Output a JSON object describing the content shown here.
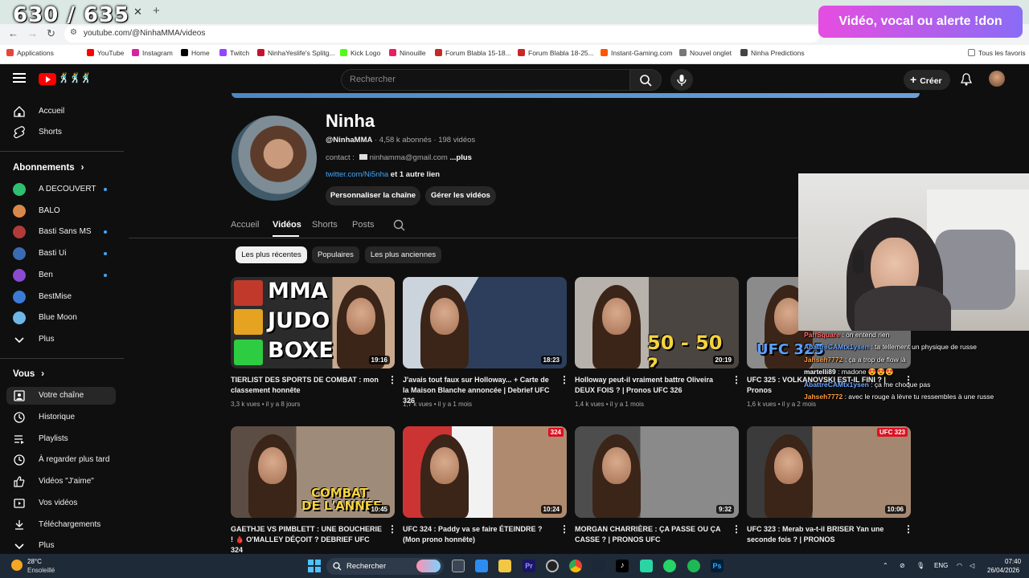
{
  "overlay": {
    "counter": "630 / 635",
    "donation_banner": "Vidéo, vocal ou alerte !don"
  },
  "browser": {
    "url": "youtube.com/@NinhaMMA/videos",
    "bookmarks": [
      {
        "label": "Applications",
        "color": "#e8453c"
      },
      {
        "label": "YouTube",
        "color": "#ff0000"
      },
      {
        "label": "Instagram",
        "color": "#d6249f"
      },
      {
        "label": "Home",
        "color": "#000000"
      },
      {
        "label": "Twitch",
        "color": "#9146ff"
      },
      {
        "label": "NinhaYeslife's Splitg...",
        "color": "#c8102e"
      },
      {
        "label": "Kick Logo",
        "color": "#53fc18"
      },
      {
        "label": "Ninouille",
        "color": "#e91e63"
      },
      {
        "label": "Forum Blabla 15-18...",
        "color": "#c62828"
      },
      {
        "label": "Forum Blabla 18-25...",
        "color": "#c62828"
      },
      {
        "label": "Instant-Gaming.com",
        "color": "#ff5400"
      },
      {
        "label": "Nouvel onglet",
        "color": "#777777"
      },
      {
        "label": "Ninha Predictions",
        "color": "#444444"
      }
    ],
    "all_bookmarks": "Tous les favoris"
  },
  "header": {
    "search_placeholder": "Rechercher",
    "create_label": "Créer"
  },
  "sidebar": {
    "main": [
      {
        "label": "Accueil",
        "icon": "home-icon"
      },
      {
        "label": "Shorts",
        "icon": "shorts-icon"
      }
    ],
    "subscriptions_title": "Abonnements",
    "subscriptions": [
      {
        "label": "A DECOUVERT",
        "color": "#2fbf71",
        "dot": true
      },
      {
        "label": "BALO",
        "color": "#d9884a",
        "dot": false
      },
      {
        "label": "Basti Sans MS",
        "color": "#b23a3a",
        "dot": true
      },
      {
        "label": "Basti Ui",
        "color": "#3a6ab2",
        "dot": true
      },
      {
        "label": "Ben",
        "color": "#8a4bd0",
        "dot": true
      },
      {
        "label": "BestMise",
        "color": "#3b7bd6",
        "dot": false
      },
      {
        "label": "Blue Moon",
        "color": "#6fb6e8",
        "dot": false
      }
    ],
    "subscriptions_more": "Plus",
    "you_title": "Vous",
    "you_items": [
      {
        "label": "Votre chaîne",
        "icon": "channel-icon",
        "active": true
      },
      {
        "label": "Historique",
        "icon": "history-icon",
        "active": false
      },
      {
        "label": "Playlists",
        "icon": "playlists-icon",
        "active": false
      },
      {
        "label": "À regarder plus tard",
        "icon": "watch-later-icon",
        "active": false
      },
      {
        "label": "Vidéos \"J'aime\"",
        "icon": "like-icon",
        "active": false
      },
      {
        "label": "Vos vidéos",
        "icon": "your-videos-icon",
        "active": false
      },
      {
        "label": "Téléchargements",
        "icon": "download-icon",
        "active": false
      }
    ],
    "you_more": "Plus"
  },
  "channel": {
    "name": "Ninha",
    "handle": "@NinhaMMA",
    "stats": " · 4,58 k abonnés · 198 vidéos",
    "contact_label": "contact : ",
    "contact_email": "ninhamma@gmail.com",
    "contact_more": "...plus",
    "link": "twitter.com/Ni5nha",
    "link_more": " et 1 autre lien",
    "customize_button": "Personnaliser la chaîne",
    "manage_button": "Gérer les vidéos",
    "tabs": [
      "Accueil",
      "Vidéos",
      "Shorts",
      "Posts"
    ],
    "active_tab": "Vidéos",
    "filters": [
      "Les plus récentes",
      "Populaires",
      "Les plus anciennes"
    ],
    "active_filter": "Les plus récentes"
  },
  "videos": [
    {
      "title": "TIERLIST DES SPORTS DE COMBAT : mon classement honnête",
      "views": "3,3 k vues",
      "age": "il y a 8 jours",
      "duration": "19:16",
      "thumb_text": [
        "MMA",
        "JUDO",
        "BOXE"
      ]
    },
    {
      "title": "J'avais tout faux sur Holloway... + Carte de la Maison Blanche annoncée | Debrief UFC 326",
      "views": "1,7 k vues",
      "age": "il y a 1 mois",
      "duration": "18:23",
      "thumb_text": []
    },
    {
      "title": "Holloway peut-il vraiment battre Oliveira DEUX FOIS ? | Pronos UFC 326",
      "views": "1,4 k vues",
      "age": "il y a 1 mois",
      "duration": "20:19",
      "thumb_text": [
        "50 - 50 ?"
      ]
    },
    {
      "title": "UFC 325 : VOLKANOVSKI EST-IL FINI ? | Pronos",
      "views": "1,6 k vues",
      "age": "il y a 2 mois",
      "duration": "",
      "thumb_text": [
        "UFC 325"
      ]
    },
    {
      "title": "GAETHJE VS PIMBLETT : UNE BOUCHERIE ! 🩸 O'MALLEY DÉÇOIT ? DEBRIEF UFC 324",
      "views": "",
      "age": "",
      "duration": "10:45",
      "thumb_text": [
        "COMBAT",
        "DE L'ANNÉE"
      ]
    },
    {
      "title": "UFC 324 : Paddy va se faire ÉTEINDRE ? (Mon prono honnête)",
      "views": "",
      "age": "",
      "duration": "10:24",
      "thumb_text": [
        "324"
      ]
    },
    {
      "title": "MORGAN CHARRIÈRE : ÇA PASSE OU ÇA CASSE ? | PRONOS UFC",
      "views": "",
      "age": "",
      "duration": "9:32",
      "thumb_text": []
    },
    {
      "title": "UFC 323 : Merab va-t-il BRISER Yan une seconde fois ? | PRONOS",
      "views": "",
      "age": "",
      "duration": "10:06",
      "thumb_text": [
        "UFC 323"
      ]
    }
  ],
  "chat": [
    {
      "user": "PaffSquare",
      "message": " : on entend rien",
      "color": "#ff6b6b"
    },
    {
      "user": "AbattreCAMtx1ysen",
      "message": " : ta tellement un physique de russe",
      "color": "#6fa8ff"
    },
    {
      "user": "Jahseh7772",
      "message": " : ça a trop de flow là",
      "color": "#ff9f43"
    },
    {
      "user": "martelli89",
      "message": " : madone 😍😍😍",
      "color": "#ffffff"
    },
    {
      "user": "AbattreCAMtx1ysen",
      "message": " : ça me choque pas",
      "color": "#6fa8ff"
    },
    {
      "user": "Jahseh7772",
      "message": " : avec le rouge à lèvre tu ressembles à une russe",
      "color": "#ff9f43"
    }
  ],
  "taskbar": {
    "weather_temp": "28°C",
    "weather_desc": "Ensoleillé",
    "search_label": "Rechercher",
    "language": "ENG",
    "time": "07:40",
    "date": "26/04/2026"
  }
}
